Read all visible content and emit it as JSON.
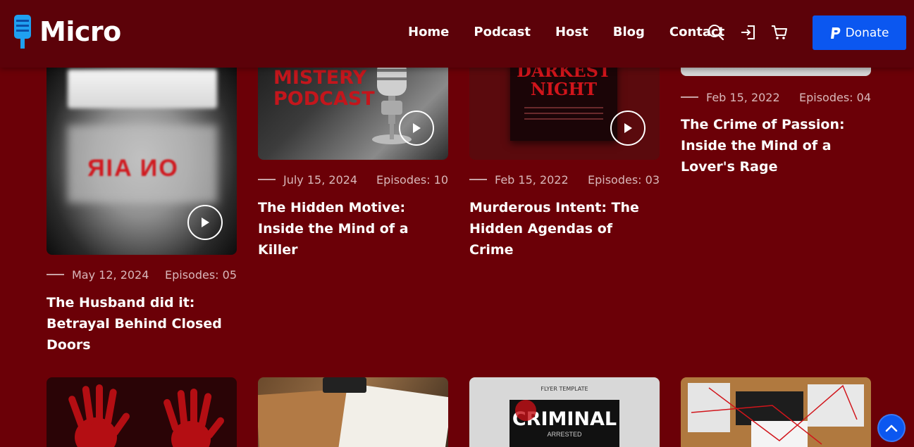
{
  "brand": {
    "name": "Micro"
  },
  "nav": {
    "items": [
      {
        "label": "Home"
      },
      {
        "label": "Podcast"
      },
      {
        "label": "Host"
      },
      {
        "label": "Blog"
      },
      {
        "label": "Contact"
      }
    ]
  },
  "header_icons": [
    "search-icon",
    "login-icon",
    "cart-icon"
  ],
  "donate": {
    "label": "Donate",
    "icon": "paypal-icon",
    "color": "#0b57f0"
  },
  "colors": {
    "background": "#6b0007",
    "header": "#5c0209",
    "accent": "#0b57f0"
  },
  "cards": [
    {
      "date": "May 12, 2024",
      "episodes": "Episodes: 05",
      "title": "The Husband did it: Betrayal Behind Closed Doors",
      "image_text": "ON AIR"
    },
    {
      "date": "July 15, 2024",
      "episodes": "Episodes: 10",
      "title": "The Hidden Motive: Inside the Mind of a Killer",
      "image_text": "MISTERY PODCAST"
    },
    {
      "date": "Feb 15, 2022",
      "episodes": "Episodes: 03",
      "title": "Murderous Intent: The Hidden Agendas of Crime",
      "image_text": "DARKEST NIGHT"
    },
    {
      "date": "Feb 15, 2022",
      "episodes": "Episodes: 04",
      "title": "The Crime of Passion: Inside the Mind of a Lover's Rage"
    }
  ],
  "bottom_cards": [
    {
      "image": "red-handprints"
    },
    {
      "image": "notebook-and-camera"
    },
    {
      "image": "criminal-flyer",
      "image_text": [
        "FLYER TEMPLATE",
        "CRIMINAL",
        "ARRESTED"
      ]
    },
    {
      "image": "evidence-board"
    }
  ]
}
